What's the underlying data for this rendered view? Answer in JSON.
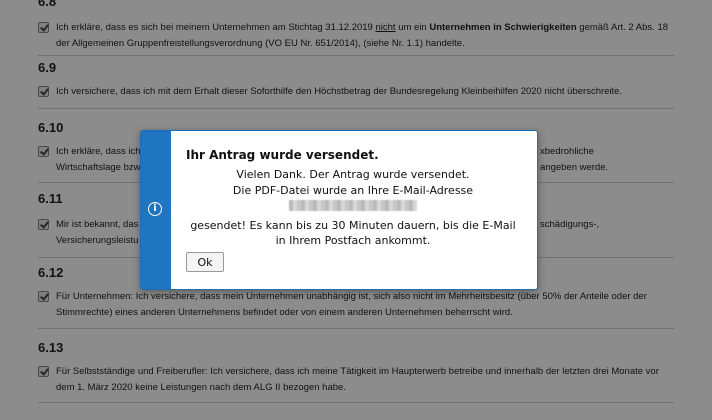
{
  "sections": [
    {
      "number": "6.8",
      "text_parts": [
        "Ich erkläre, dass es sich bei meinem Unternehmen am Stichtag 31.12.2019 ",
        "nicht",
        " um ein ",
        "Unternehmen in Schwierigkeiten",
        " gemäß Art. 2 Abs. 18 der Allgemeinen Gruppenfreistellungsverordnung (VO EU Nr. 651/2014), (siehe Nr. 1.1) handelte."
      ]
    },
    {
      "number": "6.9",
      "text": "Ich versichere, dass ich mit dem Erhalt dieser Soforthilfe den Höchstbetrag der Bundesregelung Kleinbeihilfen 2020 nicht überschreite."
    },
    {
      "number": "6.10",
      "text": "Ich erkläre, dass ich",
      "text_line2": "Wirtschaftslage bzw",
      "text_right": "xbedrohliche",
      "text_right2": "angeben werde."
    },
    {
      "number": "6.11",
      "text": "Mir ist bekannt, das",
      "text_line2": "Versicherungsleistu",
      "text_right": "schädigungs-,"
    },
    {
      "number": "6.12",
      "text": "Für Unternehmen: Ich versichere, dass mein Unternehmen unabhängig ist, sich also nicht im Mehrheitsbesitz (über 50% der Anteile oder der Stimmrechte) eines anderen Unternehmens befindet oder von einem anderen Unternehmen beherrscht wird."
    },
    {
      "number": "6.13",
      "text": "Für Selbstständige und Freiberufler: Ich versichere, dass ich meine Tätigkeit im Haupterwerb betreibe und innerhalb der letzten drei Monate vor dem 1. März 2020 keine Leistungen nach dem ALG II bezogen habe."
    }
  ],
  "dialog": {
    "title": "Ihr Antrag wurde versendet.",
    "line1": "Vielen Dank. Der Antrag wurde versendet.",
    "line2": "Die PDF-Datei wurde an Ihre E-Mail-Adresse",
    "line3": "gesendet! Es kann bis zu 30 Minuten dauern, bis die E-Mail",
    "line4": "in Ihrem Postfach ankommt.",
    "ok_label": "Ok",
    "info_icon": "i"
  },
  "colors": {
    "accent": "#1f75c0",
    "overlay": "rgba(0,0,0,0.45)"
  }
}
